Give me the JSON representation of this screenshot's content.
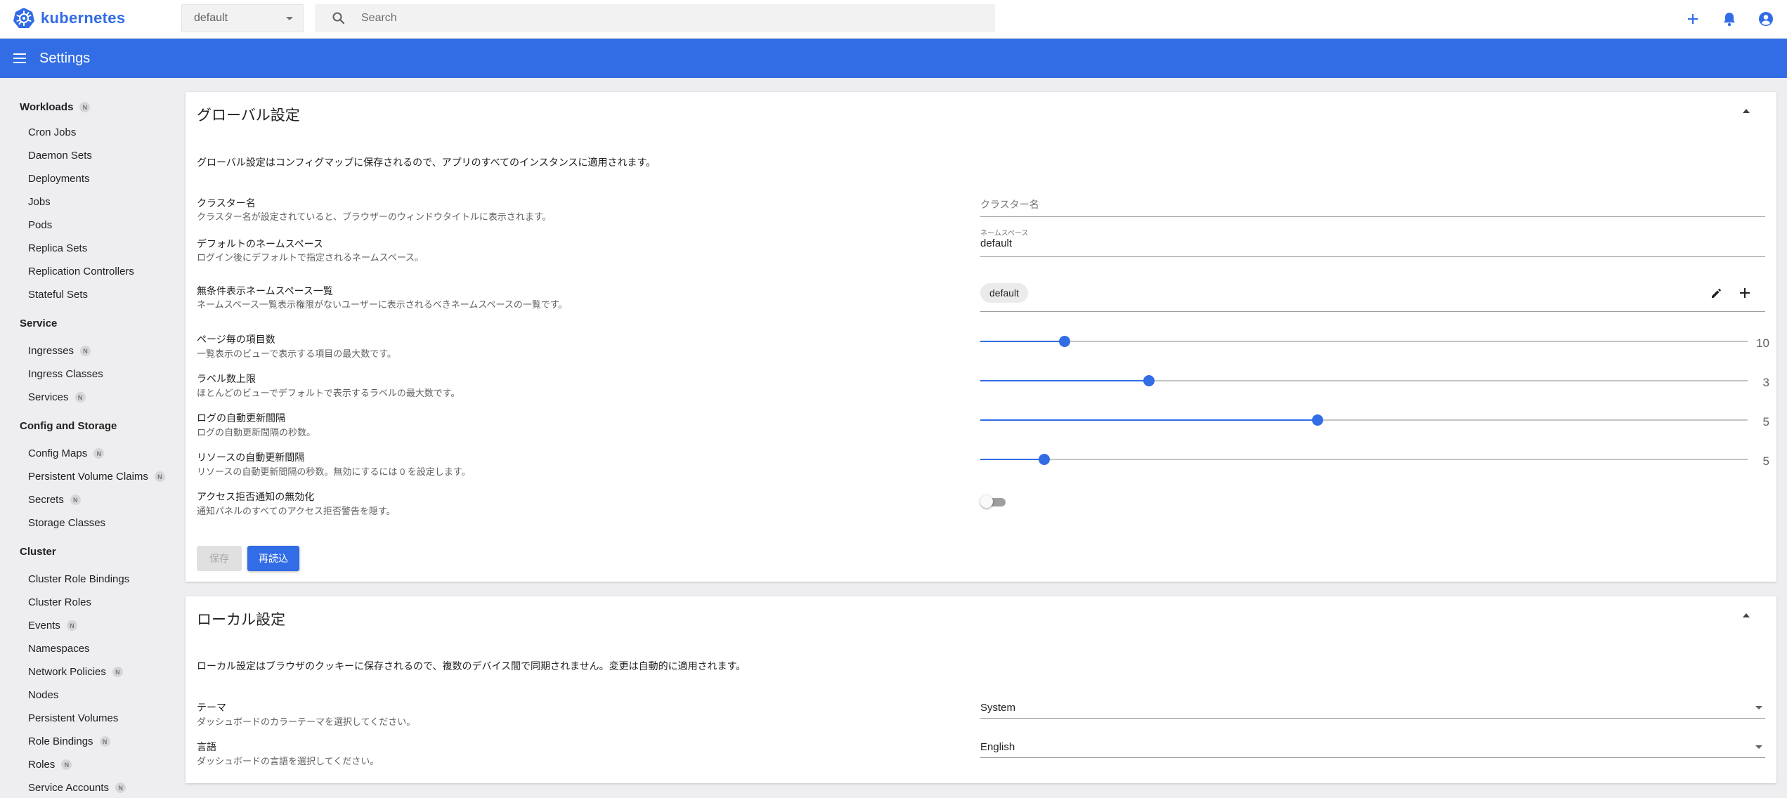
{
  "topbar": {
    "brand": "kubernetes",
    "namespace_selected": "default",
    "search_placeholder": "Search"
  },
  "header": {
    "title": "Settings"
  },
  "sidebar": {
    "sections": [
      {
        "label": "Workloads",
        "badge": "N"
      },
      {
        "label": "Service"
      },
      {
        "label": "Config and Storage"
      },
      {
        "label": "Cluster"
      }
    ],
    "items": [
      {
        "label": "Cron Jobs"
      },
      {
        "label": "Daemon Sets"
      },
      {
        "label": "Deployments"
      },
      {
        "label": "Jobs"
      },
      {
        "label": "Pods"
      },
      {
        "label": "Replica Sets"
      },
      {
        "label": "Replication Controllers"
      },
      {
        "label": "Stateful Sets"
      },
      {
        "label": "Ingresses",
        "badge": "N"
      },
      {
        "label": "Ingress Classes"
      },
      {
        "label": "Services",
        "badge": "N"
      },
      {
        "label": "Config Maps",
        "badge": "N"
      },
      {
        "label": "Persistent Volume Claims",
        "badge": "N"
      },
      {
        "label": "Secrets",
        "badge": "N"
      },
      {
        "label": "Storage Classes"
      },
      {
        "label": "Cluster Role Bindings"
      },
      {
        "label": "Cluster Roles"
      },
      {
        "label": "Events",
        "badge": "N"
      },
      {
        "label": "Namespaces"
      },
      {
        "label": "Network Policies",
        "badge": "N"
      },
      {
        "label": "Nodes"
      },
      {
        "label": "Persistent Volumes"
      },
      {
        "label": "Role Bindings",
        "badge": "N"
      },
      {
        "label": "Roles",
        "badge": "N"
      },
      {
        "label": "Service Accounts",
        "badge": "N"
      }
    ]
  },
  "global": {
    "title": "グローバル設定",
    "description": "グローバル設定はコンフィグマップに保存されるので、アプリのすべてのインスタンスに適用されます。",
    "cluster_name": {
      "label": "クラスター名",
      "sub": "クラスター名が設定されていると、ブラウザーのウィンドウタイトルに表示されます。",
      "placeholder": "クラスター名"
    },
    "default_namespace": {
      "label": "デフォルトのネームスペース",
      "sub": "ログイン後にデフォルトで指定されるネームスペース。",
      "field_label": "ネームスペース",
      "value": "default"
    },
    "namespace_fallback": {
      "label": "無条件表示ネームスペース一覧",
      "sub": "ネームスペース一覧表示権限がないユーザーに表示されるべきネームスペースの一覧です。",
      "chip": "default"
    },
    "items_per_page": {
      "label": "ページ毎の項目数",
      "sub": "一覧表示のビューで表示する項目の最大数です。",
      "value": "10",
      "fraction": 0.11
    },
    "labels_limit": {
      "label": "ラベル数上限",
      "sub": "ほとんどのビューでデフォルトで表示するラベルの最大数です。",
      "value": "3",
      "fraction": 0.22
    },
    "logs_refresh": {
      "label": "ログの自動更新間隔",
      "sub": "ログの自動更新間隔の秒数。",
      "value": "5",
      "fraction": 0.44
    },
    "resource_refresh": {
      "label": "リソースの自動更新間隔",
      "sub": "リソースの自動更新間隔の秒数。無効にするには 0 を設定します。",
      "value": "5",
      "fraction": 0.083
    },
    "disable_access_denied": {
      "label": "アクセス拒否通知の無効化",
      "sub": "通知パネルのすべてのアクセス拒否警告を隠す。",
      "enabled": false
    },
    "save_label": "保存",
    "reload_label": "再読込"
  },
  "local": {
    "title": "ローカル設定",
    "description": "ローカル設定はブラウザのクッキーに保存されるので、複数のデバイス間で同期されません。変更は自動的に適用されます。",
    "theme": {
      "label": "テーマ",
      "sub": "ダッシュボードのカラーテーマを選択してください。",
      "value": "System"
    },
    "language": {
      "label": "言語",
      "sub": "ダッシュボードの言語を選択してください。",
      "value": "English"
    }
  },
  "colors": {
    "primary": "#326de6",
    "background": "#eeeef1"
  }
}
